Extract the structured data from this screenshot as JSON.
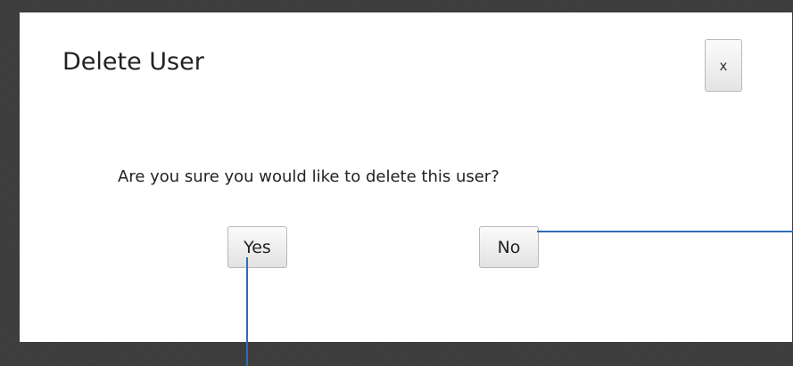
{
  "dialog": {
    "title": "Delete User",
    "close_label": "x",
    "message": "Are you sure you would like to delete this user?",
    "yes_label": "Yes",
    "no_label": "No"
  },
  "colors": {
    "backdrop": "#3c3c3c",
    "dialog_background": "#ffffff",
    "annotation_line": "#2e6db4"
  }
}
